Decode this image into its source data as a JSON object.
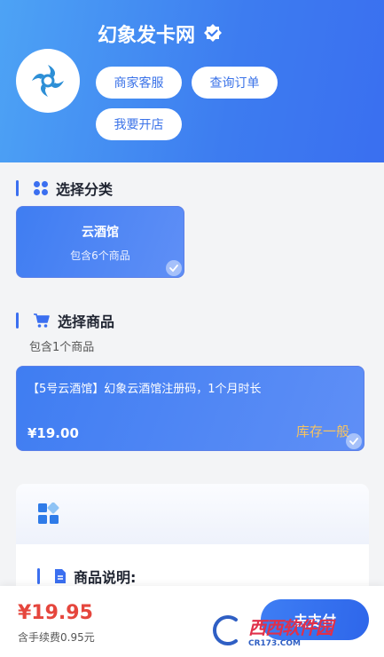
{
  "header": {
    "shop_name": "幻象发卡网",
    "buttons": {
      "support": "商家客服",
      "query_order": "查询订单",
      "open_shop": "我要开店"
    }
  },
  "category_section": {
    "title": "选择分类",
    "cards": [
      {
        "name": "云酒馆",
        "count_text": "包含6个商品",
        "selected": true
      }
    ]
  },
  "goods_section": {
    "title": "选择商品",
    "count_text": "包含1个商品",
    "items": [
      {
        "name": "【5号云酒馆】幻象云酒馆注册码，1个月时长",
        "price": "¥19.00",
        "stock": "库存一般",
        "selected": true
      }
    ]
  },
  "description": {
    "title": "商品说明:"
  },
  "checkout": {
    "total": "¥19.95",
    "fee_text": "含手续费0.95元",
    "pay_label": "去支付"
  },
  "watermark": {
    "main": "西西软件园",
    "sub": "CR173.COM"
  },
  "colors": {
    "accent": "#3b6ff0",
    "price_red": "#e5463d",
    "stock_orange": "#f6c361"
  }
}
